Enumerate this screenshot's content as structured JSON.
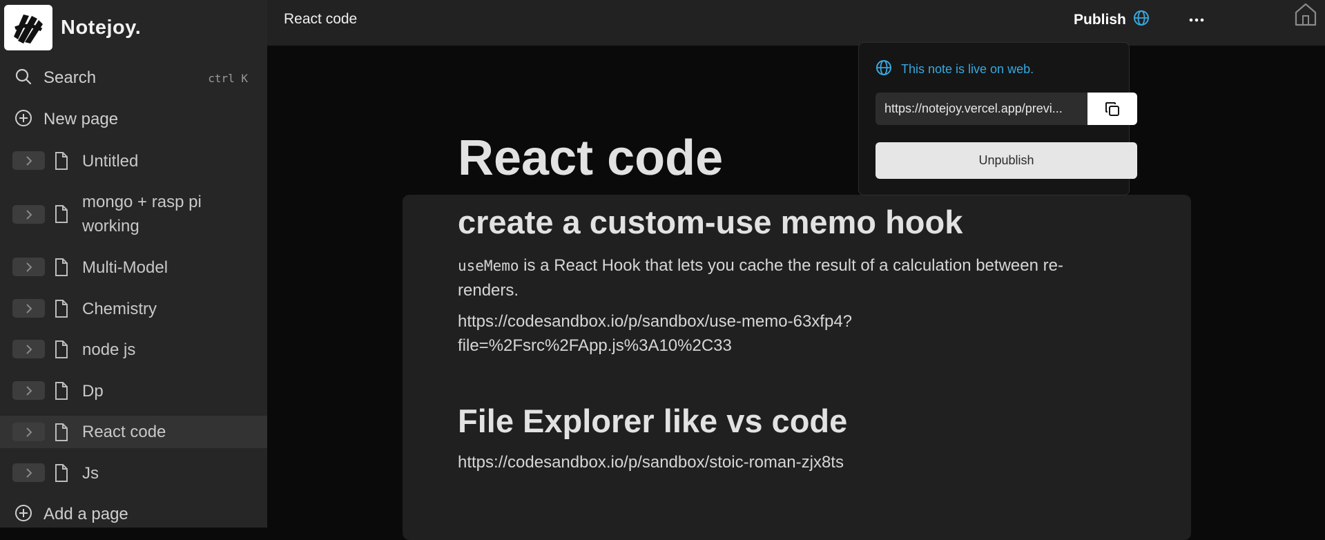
{
  "sidebar": {
    "brand": "Notejoy.",
    "search": {
      "label": "Search",
      "shortcut": "ctrl K"
    },
    "new_page": "New page",
    "pages": [
      {
        "label": "Untitled"
      },
      {
        "label": "mongo + rasp pi working"
      },
      {
        "label": "Multi-Model"
      },
      {
        "label": "Chemistry"
      },
      {
        "label": "node js"
      },
      {
        "label": "Dp"
      },
      {
        "label": "React code",
        "active": true
      },
      {
        "label": "Js"
      }
    ],
    "add_page": "Add a page"
  },
  "topbar": {
    "title": "React code",
    "publish_label": "Publish"
  },
  "popover": {
    "live_text": "This note is live on web.",
    "url": "https://notejoy.vercel.app/previ...",
    "unpublish_label": "Unpublish"
  },
  "document": {
    "title": "React code",
    "heading1": "create a custom-use memo hook",
    "para1_code": "useMemo",
    "para1_text": " is a React Hook that lets you cache the result of a calculation between re-renders.",
    "link1": "https://codesandbox.io/p/sandbox/use-memo-63xfp4?file=%2Fsrc%2FApp.js%3A10%2C33",
    "heading2": "File Explorer like vs code",
    "link2": "https://codesandbox.io/p/sandbox/stoic-roman-zjx8ts"
  },
  "colors": {
    "accent": "#38a9e0",
    "sidebar_bg": "#262626",
    "topbar_bg": "#222222",
    "content_bg": "#0a0a0a"
  },
  "icons": [
    "logo-icon",
    "search-icon",
    "plus-circle-icon",
    "chevron-right-icon",
    "document-icon",
    "globe-icon",
    "more-icon",
    "home-icon",
    "copy-icon"
  ]
}
